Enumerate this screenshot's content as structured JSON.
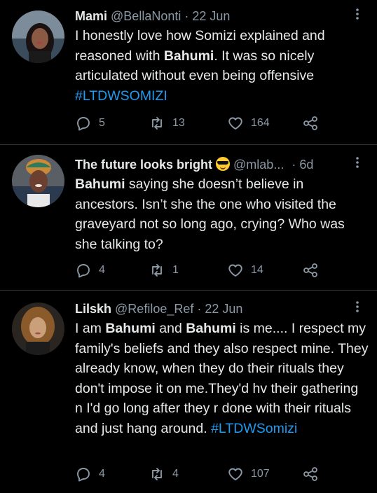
{
  "tweets": [
    {
      "name": "Mami",
      "handle": "@BellaNonti",
      "sep": "·",
      "time": "22 Jun",
      "text_parts": {
        "p1": "I honestly love how Somizi explained and reasoned with ",
        "bold1": "Bahumi",
        "p2": ". It was so nicely articulated without even being offensive",
        "hashtag": "#LTDWSOMIZI"
      },
      "replies": "5",
      "retweets": "13",
      "likes": "164"
    },
    {
      "name": "The future looks bright",
      "emoji": "sunglasses-emoji",
      "handle": "@mlab...",
      "sep": "·",
      "time": "6d",
      "text_parts": {
        "bold1": "Bahumi",
        "p1": " saying she doesn’t believe in ancestors. Isn’t she the one who visited the graveyard not so long ago, crying? Who was she talking to?"
      },
      "replies": "4",
      "retweets": "1",
      "likes": "14"
    },
    {
      "name": "Lilskh",
      "handle": "@Refiloe_Ref",
      "sep": "·",
      "time": "22 Jun",
      "text_parts": {
        "p1": "I am ",
        "bold1": "Bahumi",
        "p2": " and ",
        "bold2": "Bahumi",
        "p3": " is me.... I respect my family's beliefs  and they also respect mine. They already know, when they do their rituals  they don't impose it on me.They'd hv their gathering n I'd go long after they r done with their rituals and just hang around. ",
        "hashtag": "#LTDWSomizi"
      },
      "replies": "4",
      "retweets": "4",
      "likes": "107"
    }
  ],
  "icons": {
    "more": "more-vertical-icon",
    "reply": "reply-icon",
    "retweet": "retweet-icon",
    "like": "like-icon",
    "share": "share-icon"
  },
  "colors": {
    "background": "#000000",
    "text": "#e7e9ea",
    "secondary": "#8b98a5",
    "link": "#1d9bf0",
    "divider": "#2f3336"
  }
}
